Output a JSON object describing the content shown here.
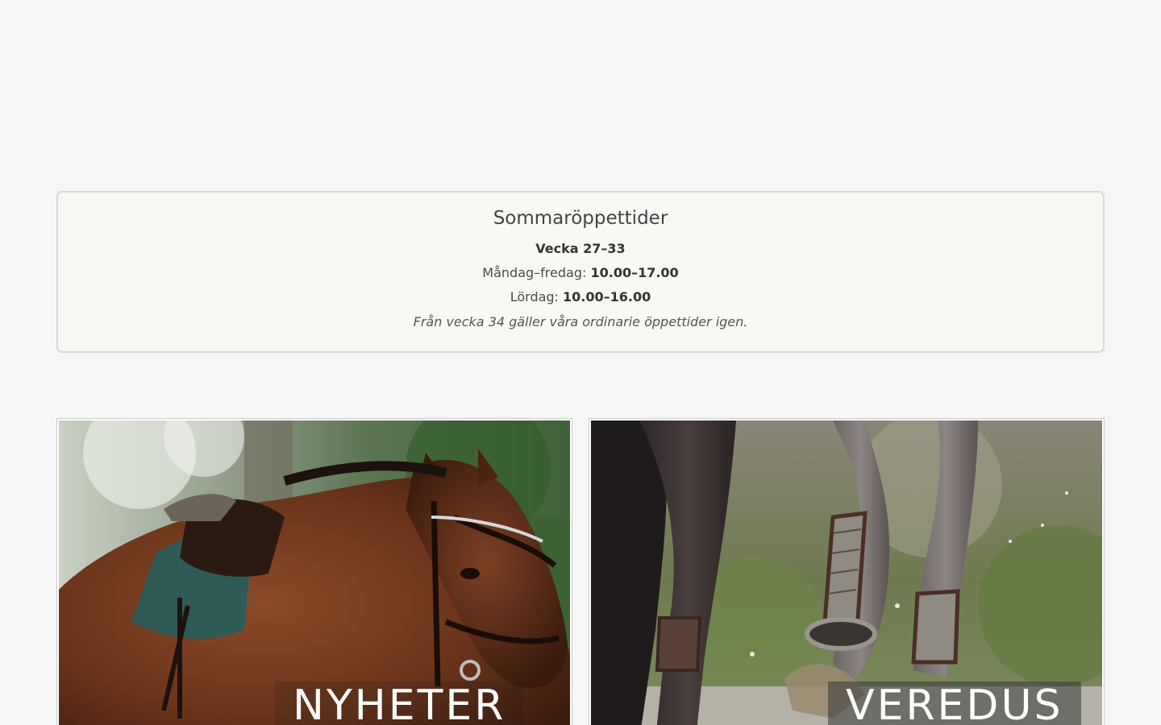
{
  "notice": {
    "title": "Sommaröppettider",
    "week": "Vecka 27–33",
    "weekdays_label": "Måndag–fredag:",
    "weekdays_hours": "10.00–17.00",
    "saturday_label": "Lördag:",
    "saturday_hours": "10.00–16.00",
    "footnote": "Från vecka 34 gäller våra ordinarie öppettider igen."
  },
  "cards": [
    {
      "label": "NYHETER",
      "image": "brown-horse-with-bridle-and-saddle"
    },
    {
      "label": "VEREDUS",
      "image": "horse-legs-with-veredus-boots-splashing"
    }
  ],
  "colors": {
    "background": "#f6f6f6",
    "notice_bg": "#faf8f4",
    "notice_border": "#dcd8cf",
    "label_text": "#ffffff"
  }
}
